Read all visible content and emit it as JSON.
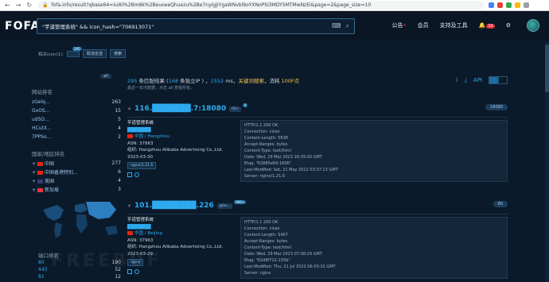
{
  "browser": {
    "url": "fofa.info/result?qbase64=IuiKI%2Bm8k%2BeuoeeQhuezu%2Be7nyIgJiYgaWNvbl9oYXNoPSI3MDY5MTMwNzEi&page=2&page_size=10",
    "back_icon": "back-arrow",
    "forward_icon": "forward-arrow",
    "reload_icon": "reload"
  },
  "header": {
    "logo": "FOFA",
    "query": "\"芋道管理系统\" && icon_hash=\"706913071\"",
    "nav": [
      "公告",
      "会员",
      "支持及工具"
    ],
    "notif_count": "10"
  },
  "related": {
    "label": "相关icon(1):",
    "icon_count": "295",
    "cancel_label": "取消全选",
    "search_label": "搜索"
  },
  "sidebar": {
    "all_label": "all",
    "site_rank_title": "网站排名",
    "sites": [
      {
        "name": "zGelq...",
        "count": "263"
      },
      {
        "name": "GxOS...",
        "count": "15"
      },
      {
        "name": "udSO...",
        "count": "5"
      },
      {
        "name": "HCutX...",
        "count": "4"
      },
      {
        "name": "7PPSo...",
        "count": "2"
      }
    ],
    "region_title": "国家/地区排名",
    "regions": [
      {
        "name": "中国",
        "count": "277",
        "flag_color": "#de2910"
      },
      {
        "name": "中国香港特别...",
        "count": "6",
        "flag_color": "#de2910"
      },
      {
        "name": "美国",
        "count": "4",
        "flag_color": "#3c3b6e"
      },
      {
        "name": "新加坡",
        "count": "3",
        "flag_color": "#ef3340"
      }
    ],
    "port_title": "端口排名",
    "ports": [
      {
        "name": "80",
        "count": "190"
      },
      {
        "name": "443",
        "count": "52"
      },
      {
        "name": "81",
        "count": "12"
      }
    ]
  },
  "summary": {
    "count": "295",
    "prefix": " 条匹配结果 (",
    "ips": "168",
    "ips_suffix": " 条独立IP ) ，",
    "ms": "1552",
    "ms_suffix": " ms，",
    "kw": "关键词搜索",
    "kw_suffix": "，消耗 ",
    "cost": "100F点",
    "sub": "最近一年内数据，点击 all 查看所有。",
    "download_icon": "download",
    "api_label": "API"
  },
  "results": [
    {
      "ip": "116.███████.7:18080",
      "port_tag": "IO+",
      "tag_count": "4",
      "port": "18080",
      "title": "芋道管理系统",
      "location": "中国 / Hangzhou",
      "asn": "ASN: 37963",
      "org": "组织: Hangzhou Alibaba Advertising Co.,Ltd.",
      "date": "2023-03-30",
      "server_tag": "nginx/1.21.6",
      "banner": [
        "HTTP/1.1 200 OK",
        "Connection: close",
        "Content-Length: 5638",
        "Accept-Ranges: bytes",
        "Content-Type: text/html",
        "Date: Wed, 29 Mar 2023 16:39:20 GMT",
        "Etag: \"62885e69-1606\"",
        "Last-Modified: Sat, 21 May 2022 03:37:13 GMT",
        "Server: nginx/1.21.6"
      ]
    },
    {
      "ip": "101.████████.226",
      "port_tag": "gGe...",
      "tag_count": "999+",
      "port": "80",
      "title": "芋道管理系统",
      "location": "中国 / Beijing",
      "asn": "ASN: 37963",
      "org": "组织: Hangzhou Alibaba Advertising Co.,Ltd.",
      "date": "2023-03-29",
      "server_tag": "nginx",
      "banner": [
        "HTTP/1.1 200 OK",
        "Connection: close",
        "Content-Length: 5467",
        "Accept-Ranges: bytes",
        "Content-Type: text/html",
        "Date: Wed, 29 Mar 2023 07:08:29 GMT",
        "Etag: \"62d8f722-155b\"",
        "Last-Modified: Thu, 21 Jul 2022 06:50:10 GMT",
        "Server: nginx"
      ]
    }
  ],
  "watermark": "FREEBUF"
}
